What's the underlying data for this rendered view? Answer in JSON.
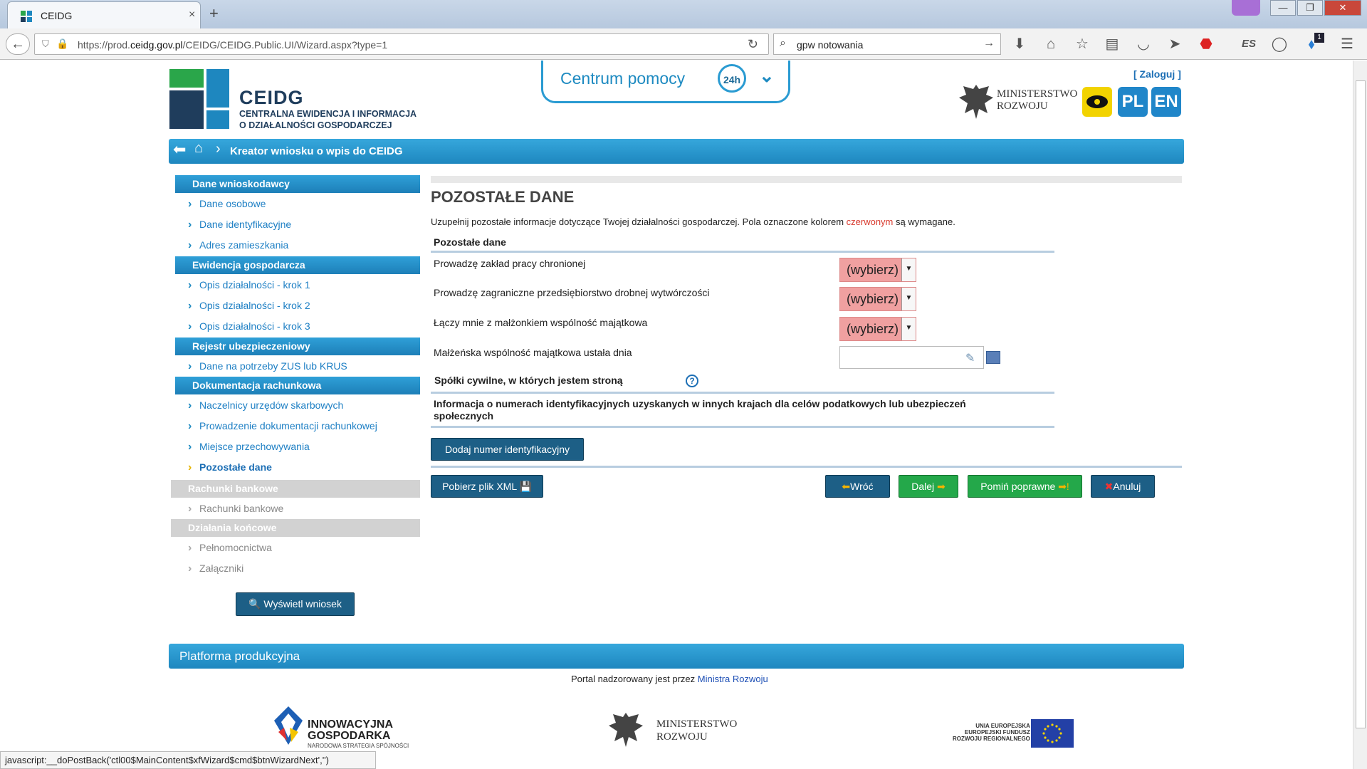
{
  "browser": {
    "tab_title": "CEIDG",
    "tab_close": "×",
    "new_tab": "+",
    "url_prefix": "https://prod.",
    "url_domain": "ceidg.gov.pl",
    "url_suffix": "/CEIDG/CEIDG.Public.UI/Wizard.aspx?type=1",
    "search_value": "gpw notowania",
    "status_text": "javascript:__doPostBack('ctl00$MainContent$xfWizard$cmd$btnWizardNext','')",
    "win_min": "—",
    "win_max": "❐",
    "win_close": "✕",
    "notif_count": "1"
  },
  "header": {
    "logo_title": "CEIDG",
    "logo_sub1": "CENTRALNA EWIDENCJA I INFORMACJA",
    "logo_sub2": "O DZIAŁALNOŚCI GOSPODARCZEJ",
    "help_text": "Centrum pomocy",
    "help_badge": "24h",
    "login": "[ Zaloguj ]",
    "ministry_line1": "MINISTERSTWO",
    "ministry_line2": "ROZWOJU",
    "lang_pl": "PL",
    "lang_en": "EN",
    "wizard_title": "Kreator wniosku o wpis do CEIDG"
  },
  "sidebar": {
    "sections": [
      {
        "label": "Dane wnioskodawcy"
      },
      {
        "label": "Ewidencja gospodarcza"
      },
      {
        "label": "Rejestr ubezpieczeniowy"
      },
      {
        "label": "Dokumentacja rachunkowa"
      },
      {
        "label": "Rachunki bankowe"
      },
      {
        "label": "Działania końcowe"
      }
    ],
    "items": [
      {
        "label": "Dane osobowe"
      },
      {
        "label": "Dane identyfikacyjne"
      },
      {
        "label": "Adres zamieszkania"
      },
      {
        "label": "Opis działalności - krok 1"
      },
      {
        "label": "Opis działalności - krok 2"
      },
      {
        "label": "Opis działalności - krok 3"
      },
      {
        "label": "Dane na potrzeby ZUS lub KRUS"
      },
      {
        "label": "Naczelnicy urzędów skarbowych"
      },
      {
        "label": "Prowadzenie dokumentacji rachunkowej"
      },
      {
        "label": "Miejsce przechowywania"
      },
      {
        "label": "Pozostałe dane"
      },
      {
        "label": "Rachunki bankowe"
      },
      {
        "label": "Pełnomocnictwa"
      },
      {
        "label": "Załączniki"
      }
    ],
    "show_button": "Wyświetl wniosek"
  },
  "main": {
    "title": "POZOSTAŁE DANE",
    "intro_before": "Uzupełnij pozostałe informacje dotyczące Twojej działalności gospodarczej. Pola oznaczone kolorem ",
    "intro_red": "czerwonym",
    "intro_after": " są wymagane.",
    "section_label": "Pozostałe dane",
    "fields": [
      {
        "label": "Prowadzę zakład pracy chronionej",
        "value": "(wybierz)"
      },
      {
        "label": "Prowadzę zagraniczne przedsiębiorstwo drobnej wytwórczości",
        "value": "(wybierz)"
      },
      {
        "label": "Łączy mnie z małżonkiem wspólność majątkowa",
        "value": "(wybierz)"
      }
    ],
    "date_label": "Małżeńska wspólność majątkowa ustała dnia",
    "date_value": "",
    "spolki_label": "Spółki cywilne, w których jestem stroną",
    "info_title": "Informacja o numerach identyfikacyjnych uzyskanych w innych krajach dla celów podatkowych lub ubezpieczeń społecznych",
    "add_id_button": "Dodaj numer identyfikacyjny",
    "xml_button": "Pobierz plik XML",
    "back_button": "Wróć",
    "next_button": "Dalej",
    "skip_button": "Pomiń poprawne",
    "cancel_button": "Anuluj"
  },
  "footer": {
    "platform": "Platforma produkcyjna",
    "portal_text": "Portal nadzorowany jest przez ",
    "portal_link": "Ministra Rozwoju",
    "ig_line1": "INNOWACYJNA",
    "ig_line2": "GOSPODARKA",
    "ig_sub": "NARODOWA STRATEGIA SPÓJNOŚCI",
    "min_line1": "MINISTERSTWO",
    "min_line2": "ROZWOJU",
    "ue_line1": "UNIA EUROPEJSKA",
    "ue_line2": "EUROPEJSKI FUNDUSZ",
    "ue_line3": "ROZWOJU REGIONALNEGO"
  },
  "colors": {
    "accent": "#1e87bf",
    "required": "#f0a0a0",
    "green": "#24a84a",
    "dark_button": "#1d5f86"
  }
}
